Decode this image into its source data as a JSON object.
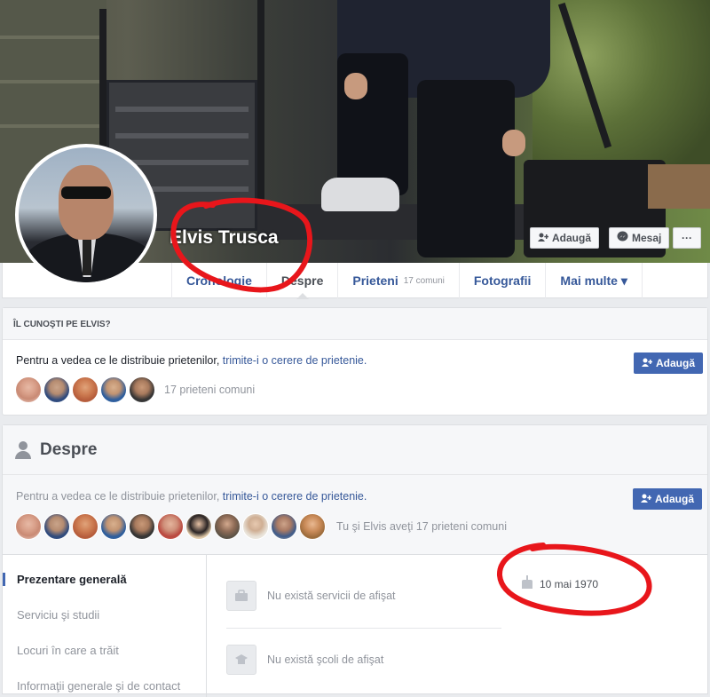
{
  "profile": {
    "name": "Elvis Trusca",
    "actions": {
      "add_label": "Adaugă",
      "message_label": "Mesaj",
      "more_label": "···"
    }
  },
  "tabs": [
    {
      "label": "Cronologie"
    },
    {
      "label": "Despre"
    },
    {
      "label": "Prieteni",
      "sub": "17 comuni"
    },
    {
      "label": "Fotografii"
    },
    {
      "label": "Mai multe ▾"
    }
  ],
  "know_card": {
    "heading": "ÎL CUNOŞTI PE ELVIS?",
    "text_plain": "Pentru a vedea ce le distribuie prietenilor, ",
    "text_link": "trimite-i o cerere de prietenie.",
    "add_button": "Adaugă",
    "mutual_friends": "17 prieteni comuni"
  },
  "about": {
    "title": "Despre",
    "invite_plain": "Pentru a vedea ce le distribuie prietenilor, ",
    "invite_link": "trimite-i o cerere de prietenie.",
    "add_button": "Adaugă",
    "mutual_text": "Tu şi Elvis aveţi 17 prieteni comuni",
    "nav": [
      "Prezentare generală",
      "Serviciu şi studii",
      "Locuri în care a trăit",
      "Informaţii generale şi de contact"
    ],
    "work_empty": "Nu există servicii de afişat",
    "school_empty": "Nu există şcoli de afişat",
    "birthday": "10 mai 1970"
  },
  "colors": {
    "accent": "#4267b2",
    "link": "#365899",
    "annotation_red": "#e8161b"
  }
}
